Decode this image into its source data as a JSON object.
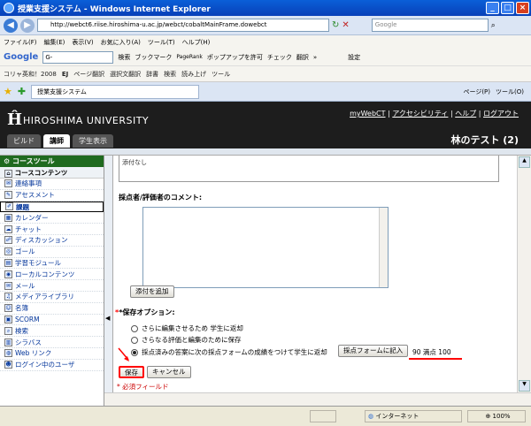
{
  "window": {
    "title": "授業支援システム - Windows Internet Explorer",
    "buttons": [
      "_",
      "□",
      "×"
    ]
  },
  "address": {
    "url": "http://webct6.riise.hiroshima-u.ac.jp/webct/cobaltMainFrame.dowebct",
    "search_placeholder": "Google"
  },
  "menu": [
    "ファイル(F)",
    "編集(E)",
    "表示(V)",
    "お気に入り(A)",
    "ツール(T)",
    "ヘルプ(H)"
  ],
  "google_toolbar": {
    "logo": "Google",
    "g_input": "G-",
    "items": [
      "検索",
      "ブックマーク",
      "PageRank",
      "ポップアップを許可",
      "チェック",
      "翻訳",
      "»",
      "設定"
    ]
  },
  "links_bar": {
    "items": [
      "コリャ英和！2008",
      "EJ",
      "ページ翻訳",
      "選択文翻訳",
      "辞書",
      "検索",
      "読み上げ",
      "ツール"
    ]
  },
  "ie_tab": {
    "label": "授業支援システム",
    "right_items": [
      "ページ(P)",
      "ツール(O)"
    ]
  },
  "header": {
    "university": "HIROSHIMA UNIVERSITY",
    "top_links": [
      "myWebCT",
      "アクセシビリティ",
      "ヘルプ",
      "ログアウト"
    ],
    "role_tabs": [
      "ビルド",
      "講師",
      "学生表示"
    ],
    "active_role": "講師",
    "course": "林のテスト (2)"
  },
  "sidebar": {
    "title": "コースツール",
    "items": [
      {
        "label": "コースコンテンツ",
        "group": true
      },
      {
        "label": "連絡事項"
      },
      {
        "label": "アセスメント"
      },
      {
        "label": "課題",
        "selected": true
      },
      {
        "label": "カレンダー"
      },
      {
        "label": "チャット"
      },
      {
        "label": "ディスカッション"
      },
      {
        "label": "ゴール"
      },
      {
        "label": "学習モジュール"
      },
      {
        "label": "ローカルコンテンツ"
      },
      {
        "label": "メール"
      },
      {
        "label": "メディアライブラリ"
      },
      {
        "label": "名簿"
      },
      {
        "label": "SCORM"
      },
      {
        "label": "検索"
      },
      {
        "label": "シラバス"
      },
      {
        "label": "Web リンク"
      },
      {
        "label": "ログイン中のユーザ"
      }
    ]
  },
  "main": {
    "prev_text": "添付なし",
    "comment_label": "採点者/評価者のコメント:",
    "attach_button": "添付を追加",
    "save_options_label": "*保存オプション:",
    "options": [
      "さらに編集させるため 学生に返却",
      "さらなる評価と編集のために保存",
      "採点済みの答案に次の採点フォームの成績をつけて学生に返却"
    ],
    "selected_option": 2,
    "grade_form_button": "採点フォームに記入",
    "score_text": "90 満点 100",
    "save_button": "保存",
    "cancel_button": "キャンセル",
    "required_note": "* 必須フィールド",
    "accent_red": "#ff0000"
  },
  "status": {
    "zone": "インターネット",
    "zoom": "100%"
  }
}
